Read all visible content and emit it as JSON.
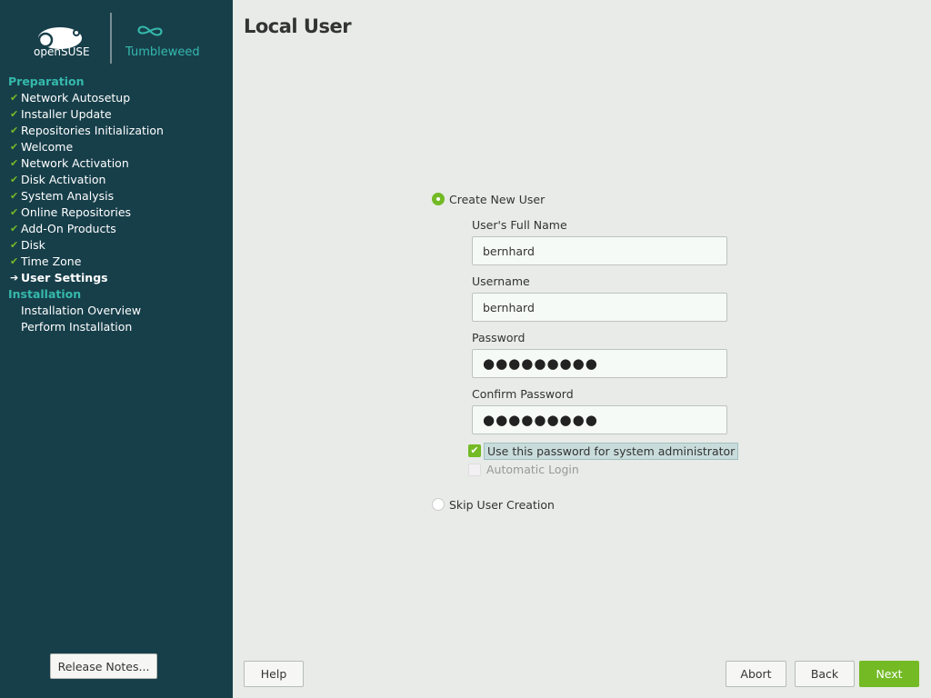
{
  "sidebar": {
    "logo": {
      "brand": "openSUSE",
      "edition": "Tumbleweed"
    },
    "sections": [
      {
        "title": "Preparation",
        "steps": [
          {
            "label": "Network Autosetup",
            "status": "done"
          },
          {
            "label": "Installer Update",
            "status": "done"
          },
          {
            "label": "Repositories Initialization",
            "status": "done"
          },
          {
            "label": "Welcome",
            "status": "done"
          },
          {
            "label": "Network Activation",
            "status": "done"
          },
          {
            "label": "Disk Activation",
            "status": "done"
          },
          {
            "label": "System Analysis",
            "status": "done"
          },
          {
            "label": "Online Repositories",
            "status": "done"
          },
          {
            "label": "Add-On Products",
            "status": "done"
          },
          {
            "label": "Disk",
            "status": "done"
          },
          {
            "label": "Time Zone",
            "status": "done"
          },
          {
            "label": "User Settings",
            "status": "current"
          }
        ]
      },
      {
        "title": "Installation",
        "steps": [
          {
            "label": "Installation Overview",
            "status": "pending"
          },
          {
            "label": "Perform Installation",
            "status": "pending"
          }
        ]
      }
    ],
    "release_notes": "Release Notes..."
  },
  "main": {
    "title": "Local User",
    "create_new_user": "Create New User",
    "full_name_label": "User's Full Name",
    "full_name_value": "bernhard",
    "username_label": "Username",
    "username_value": "bernhard",
    "password_label": "Password",
    "password_value": "●●●●●●●●●",
    "confirm_label": "Confirm Password",
    "confirm_value": "●●●●●●●●●",
    "use_for_admin": "Use this password for system administrator",
    "use_for_admin_checked": true,
    "auto_login": "Automatic Login",
    "auto_login_checked": false,
    "skip_user": "Skip User Creation",
    "selected": "create"
  },
  "buttons": {
    "help": "Help",
    "abort": "Abort",
    "back": "Back",
    "next": "Next"
  },
  "colors": {
    "sidebar": "#173f4a",
    "accent": "#73ba25",
    "teal": "#35b9ab"
  }
}
